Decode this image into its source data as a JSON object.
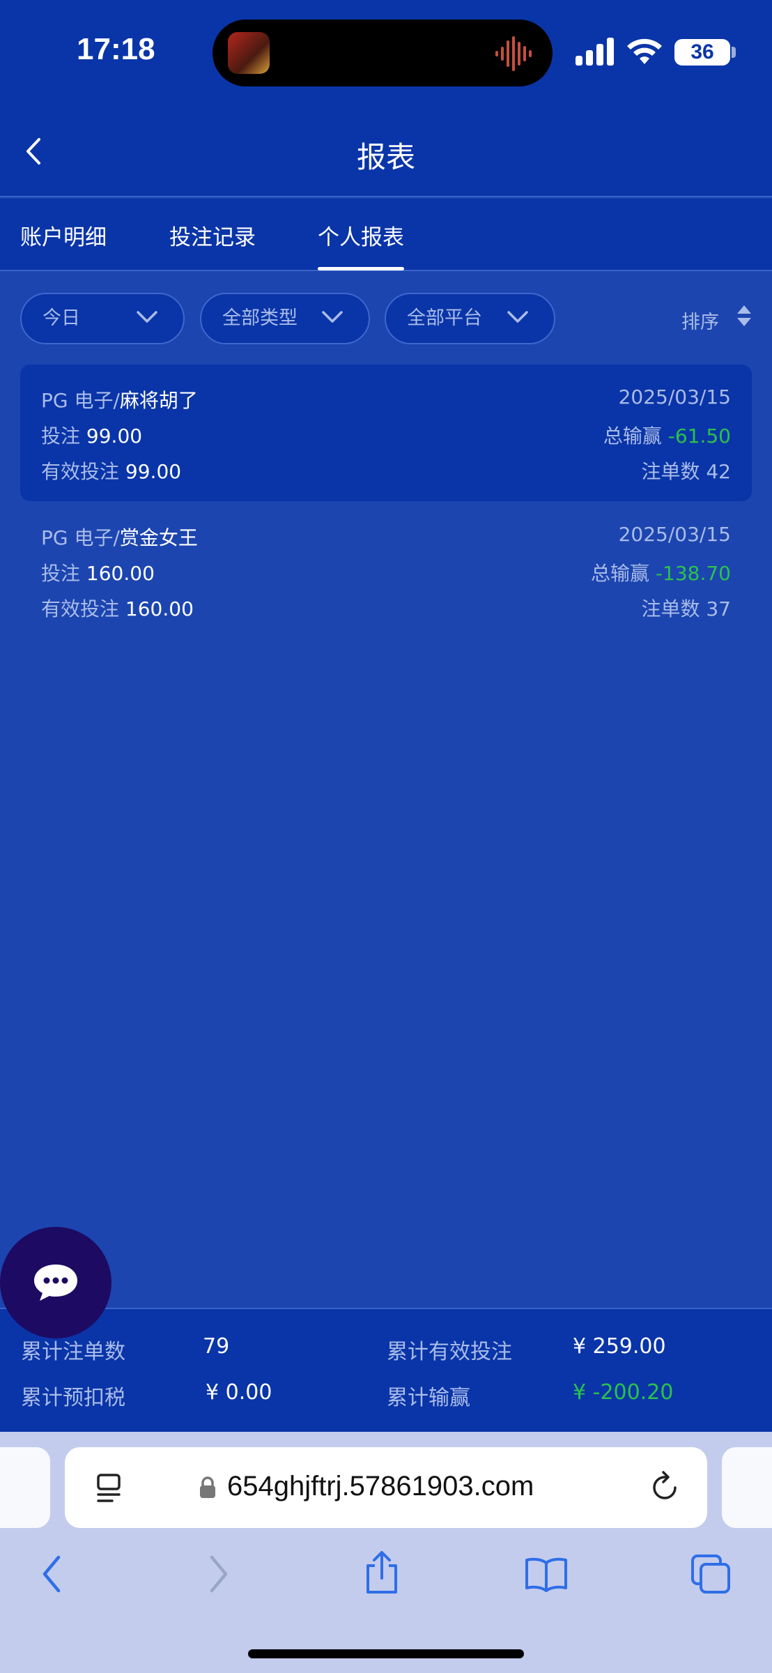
{
  "status_bar": {
    "time": "17:18",
    "battery": "36"
  },
  "nav": {
    "title": "报表"
  },
  "tabs": [
    {
      "label": "账户明细",
      "active": false
    },
    {
      "label": "投注记录",
      "active": false
    },
    {
      "label": "个人报表",
      "active": true
    }
  ],
  "filters": {
    "date": "今日",
    "type": "全部类型",
    "platform": "全部平台",
    "sort_label": "排序"
  },
  "records": [
    {
      "platform": "PG 电子/",
      "game": "麻将胡了",
      "date": "2025/03/15",
      "bet_label": "投注",
      "bet": "99.00",
      "win_label": "总输赢",
      "win": "-61.50",
      "valid_bet_label": "有效投注",
      "valid_bet": "99.00",
      "count_label": "注单数",
      "count": "42"
    },
    {
      "platform": "PG 电子/",
      "game": "赏金女王",
      "date": "2025/03/15",
      "bet_label": "投注",
      "bet": "160.00",
      "win_label": "总输赢",
      "win": "-138.70",
      "valid_bet_label": "有效投注",
      "valid_bet": "160.00",
      "count_label": "注单数",
      "count": "37"
    }
  ],
  "summary": {
    "total_count_label": "累计注单数",
    "total_count": "79",
    "total_valid_label": "累计有效投注",
    "total_valid": "¥ 259.00",
    "tax_label": "累计预扣税",
    "tax": "¥ 0.00",
    "total_win_label": "累计输赢",
    "total_win": "¥ -200.20"
  },
  "browser": {
    "url": "654ghjftrj.57861903.com"
  },
  "colors": {
    "header_bg": "#0a35a8",
    "content_bg": "#1c45b0",
    "negative": "#2bc24a",
    "muted_text": "#aabce8"
  }
}
